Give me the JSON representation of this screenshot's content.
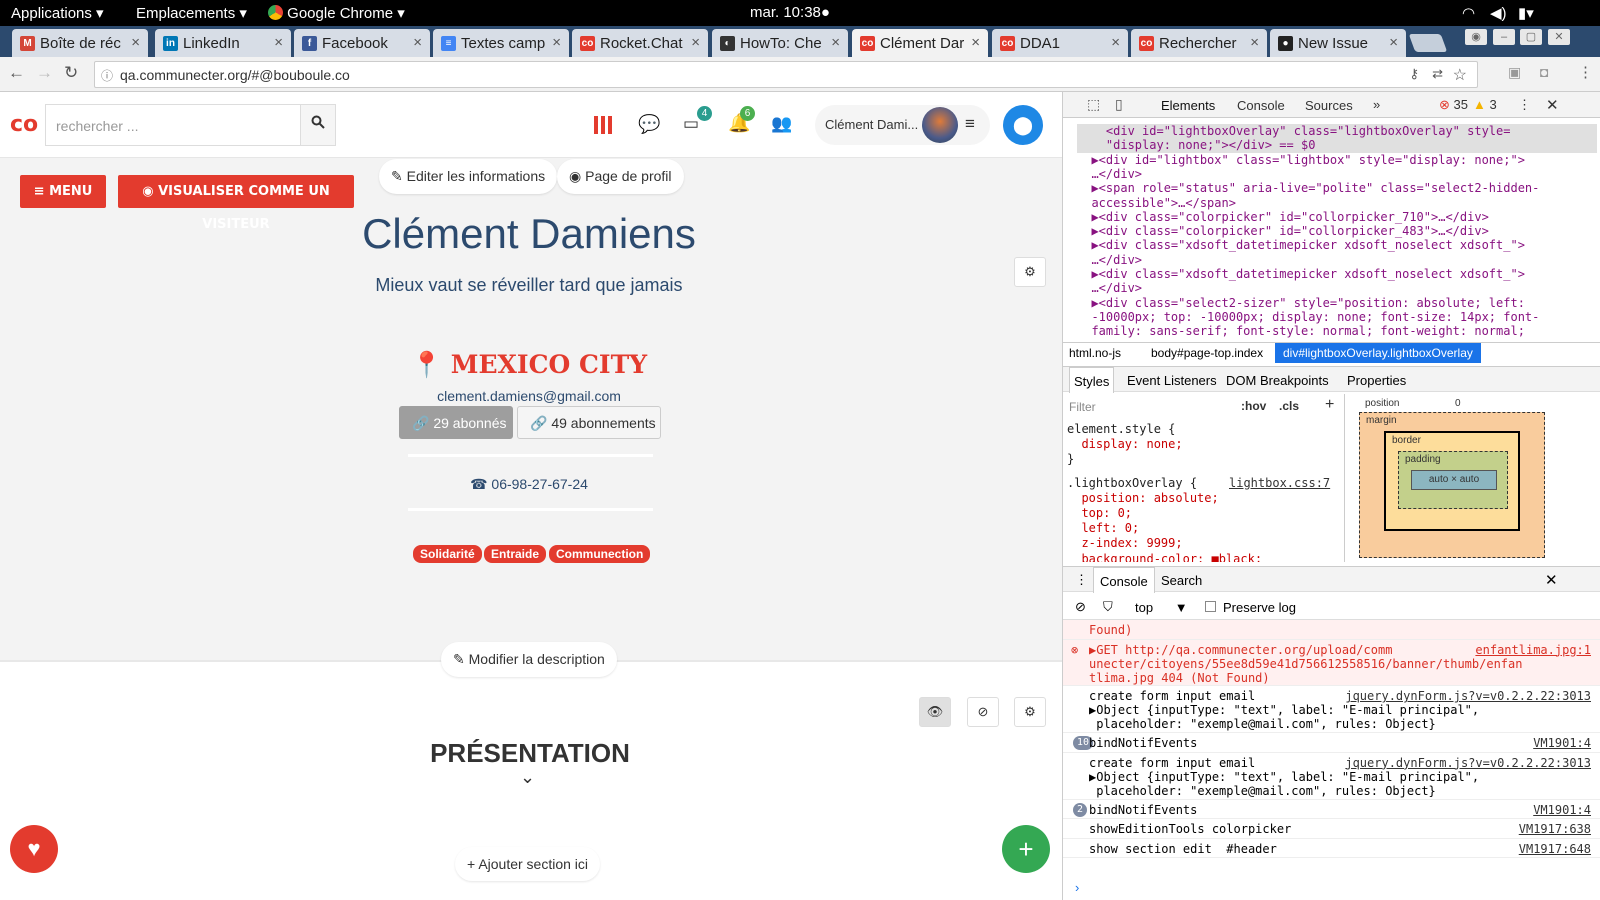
{
  "system_bar": {
    "applications": "Applications",
    "places": "Emplacements",
    "chrome": "Google Chrome",
    "clock": "mar. 10:38"
  },
  "tabs": [
    {
      "title": "Boîte de réc",
      "icon": "gmail-icon",
      "color": "#d44638",
      "glyph": "M"
    },
    {
      "title": "LinkedIn",
      "icon": "linkedin-icon",
      "color": "#0077b5",
      "glyph": "in"
    },
    {
      "title": "Facebook",
      "icon": "facebook-icon",
      "color": "#3b5998",
      "glyph": "f"
    },
    {
      "title": "Textes camp",
      "icon": "docs-icon",
      "color": "#4285f4",
      "glyph": "≡"
    },
    {
      "title": "Rocket.Chat",
      "icon": "communecter-icon",
      "color": "#e33b2e",
      "glyph": "co"
    },
    {
      "title": "HowTo: Che",
      "icon": "howto-icon",
      "color": "#333333",
      "glyph": "◐"
    },
    {
      "title": "Clément Dar",
      "icon": "communecter-icon",
      "color": "#e33b2e",
      "glyph": "co",
      "active": true
    },
    {
      "title": "DDA1",
      "icon": "communecter-icon",
      "color": "#e33b2e",
      "glyph": "co"
    },
    {
      "title": "Rechercher",
      "icon": "communecter-icon",
      "color": "#e33b2e",
      "glyph": "co"
    },
    {
      "title": "New Issue",
      "icon": "github-icon",
      "color": "#222222",
      "glyph": "●"
    }
  ],
  "url": "qa.communecter.org/#@bouboule.co",
  "site": {
    "logo": "co",
    "search_placeholder": "rechercher ...",
    "inbox_badge": "4",
    "notif_badge": "6",
    "username": "Clément Dami..."
  },
  "profile": {
    "menu": "MENU",
    "visitor": "VISUALISER COMME UN VISITEUR",
    "edit_info": "Editer les informations",
    "profile_page": "Page de profil",
    "name": "Clément Damiens",
    "tagline": "Mieux vaut se réveiller tard que jamais",
    "city": "MEXICO CITY",
    "email": "clement.damiens@gmail.com",
    "followers": "29 abonnés",
    "following": "49 abonnements",
    "phone": "06-98-27-67-24",
    "tags": [
      "Solidarité",
      "Entraide",
      "Communection"
    ],
    "edit_desc": "Modifier la description",
    "presentation": "PRÉSENTATION",
    "add_section": "Ajouter section ici"
  },
  "devtools": {
    "tabs": [
      "Elements",
      "Console",
      "Sources"
    ],
    "errors": "35",
    "warnings": "3",
    "dom_lines": [
      {
        "t": "    <div id=\"lightboxOverlay\" class=\"lightboxOverlay\" style=",
        "sel": true
      },
      {
        "t": "    \"display: none;\"></div> == $0",
        "sel": true
      },
      {
        "t": "  ▶<div id=\"lightbox\" class=\"lightbox\" style=\"display: none;\">"
      },
      {
        "t": "  …</div>"
      },
      {
        "t": "  ▶<span role=\"status\" aria-live=\"polite\" class=\"select2-hidden-"
      },
      {
        "t": "  accessible\">…</span>"
      },
      {
        "t": "  ▶<div class=\"colorpicker\" id=\"collorpicker_710\">…</div>"
      },
      {
        "t": "  ▶<div class=\"colorpicker\" id=\"collorpicker_483\">…</div>"
      },
      {
        "t": "  ▶<div class=\"xdsoft_datetimepicker xdsoft_noselect xdsoft_\">"
      },
      {
        "t": "  …</div>"
      },
      {
        "t": "  ▶<div class=\"xdsoft_datetimepicker xdsoft_noselect xdsoft_\">"
      },
      {
        "t": "  …</div>"
      },
      {
        "t": "  ▶<div class=\"select2-sizer\" style=\"position: absolute; left:"
      },
      {
        "t": "  -10000px; top: -10000px; display: none; font-size: 14px; font-"
      },
      {
        "t": "  family: sans-serif; font-style: normal; font-weight: normal;"
      }
    ],
    "breadcrumb": [
      "html.no-js",
      "body#page-top.index",
      "div#lightboxOverlay.lightboxOverlay"
    ],
    "style_tabs": [
      "Styles",
      "Event Listeners",
      "DOM Breakpoints",
      "Properties"
    ],
    "filter": "Filter",
    "hov": ":hov",
    "cls": ".cls",
    "css_lines": [
      "element.style {",
      "  display: none;",
      "}",
      ".lightboxOverlay {",
      "  position: absolute;",
      "  top: 0;",
      "  left: 0;",
      "  z-index: 9999;",
      "  background-color: ■black;"
    ],
    "css_source": "lightbox.css:7",
    "box": {
      "position": "position",
      "zero": "0",
      "margin": "margin",
      "border": "border",
      "padding": "padding",
      "content": "auto × auto",
      "dash": "–"
    },
    "console_tabs": [
      "Console",
      "Search"
    ],
    "context": "top",
    "preserve": "Preserve log",
    "console_lines": [
      {
        "text": "Found)",
        "type": "err"
      },
      {
        "text": "▶GET http://qa.communecter.org/upload/comm\nunecter/citoyens/55ee8d59e41d756612558516/banner/thumb/enfan\ntlima.jpg 404 (Not Found)",
        "src": "enfantlima.jpg:1",
        "type": "err"
      },
      {
        "text": "create form input email\n▶Object {inputType: \"text\", label: \"E-mail principal\",\n placeholder: \"exemple@mail.com\", rules: Object}",
        "src": "jquery.dynForm.js?v=v0.2.2.22:3013"
      },
      {
        "text": "bindNotifEvents",
        "src": "VM1901:4",
        "count": "10"
      },
      {
        "text": "create form input email\n▶Object {inputType: \"text\", label: \"E-mail principal\",\n placeholder: \"exemple@mail.com\", rules: Object}",
        "src": "jquery.dynForm.js?v=v0.2.2.22:3013"
      },
      {
        "text": "bindNotifEvents",
        "src": "VM1901:4",
        "count": "2"
      },
      {
        "text": "showEditionTools colorpicker",
        "src": "VM1917:638"
      },
      {
        "text": "show section edit  #header",
        "src": "VM1917:648"
      }
    ]
  },
  "colors": {
    "accent": "#e33b2e",
    "blue": "#1e88e5",
    "green": "#34a853"
  }
}
